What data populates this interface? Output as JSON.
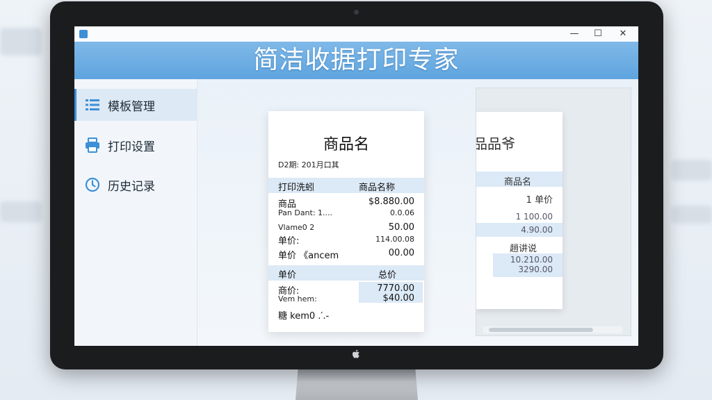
{
  "window": {
    "title": "简洁收据打印专家",
    "minimize": "—",
    "maximize": "☐",
    "close": "✕"
  },
  "sidebar": {
    "items": [
      {
        "label": "模板管理",
        "icon": "list-icon",
        "active": true
      },
      {
        "label": "打印设置",
        "icon": "printer-icon",
        "active": false
      },
      {
        "label": "历史记录",
        "icon": "clock-icon",
        "active": false
      }
    ]
  },
  "receipt": {
    "title": "商品名",
    "date": "D2期: 201月口其",
    "header": {
      "left": "打印洗蚓",
      "right": "商品名称"
    },
    "lines": [
      {
        "left": "商品",
        "right": "$8.880.00"
      },
      {
        "left": "Pan Dant: 1....",
        "right": "0.0.06"
      },
      {
        "left": "Vlame0 2",
        "right": "50.00"
      },
      {
        "left": "单价:",
        "right": "114.00.08"
      },
      {
        "left": "单价 《ancem",
        "right": "00.00"
      }
    ],
    "total_header": {
      "left": "单价",
      "right": "总价"
    },
    "total_lines": [
      {
        "left": "商价:",
        "right": "7770.00"
      },
      {
        "left": "Vem hem:",
        "right": "$40.00"
      }
    ],
    "footer": "糖 kem0 .′.-"
  },
  "preview": {
    "title": "品品爷",
    "header": "商品名",
    "lines": [
      {
        "right": "1 单价"
      },
      {
        "right": "1 100.00"
      },
      {
        "right": "4.90.00"
      }
    ],
    "subheader": "趙讲说",
    "sub_lines": [
      {
        "right": "10.210.00"
      },
      {
        "right": "3290.00"
      }
    ]
  }
}
